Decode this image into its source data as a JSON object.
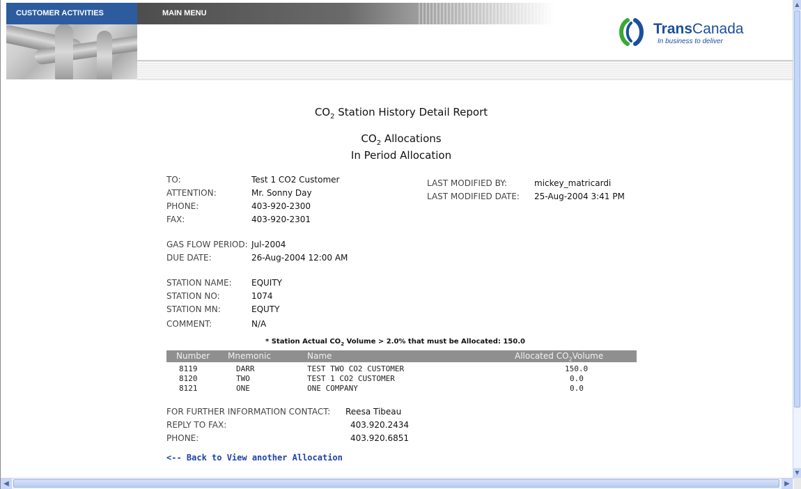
{
  "nav": {
    "customer_activities": "CUSTOMER ACTIVITIES",
    "main_menu": "MAIN MENU"
  },
  "logo": {
    "name_bold": "Trans",
    "name_rest": "Canada",
    "tagline": "In business to deliver",
    "colors": {
      "green": "#39a935",
      "blue": "#1a4f9c"
    }
  },
  "report": {
    "title_pre": "CO",
    "title_sub": "2",
    "title_post": " Station History Detail Report",
    "subtitle_pre": "CO",
    "subtitle_sub": "2",
    "subtitle_post": " Allocations",
    "subtitle2": "In Period Allocation"
  },
  "contact": {
    "to_label": "TO:",
    "to_value": "Test 1 CO2 Customer",
    "attention_label": "ATTENTION:",
    "attention_value": "Mr. Sonny Day",
    "phone_label": "PHONE:",
    "phone_value": "403-920-2300",
    "fax_label": "FAX:",
    "fax_value": "403-920-2301",
    "modified_by_label": "LAST MODIFIED BY:",
    "modified_by_value": "mickey_matricardi",
    "modified_date_label": "LAST MODIFIED DATE:",
    "modified_date_value": "25-Aug-2004 3:41 PM"
  },
  "period": {
    "gas_flow_label": "GAS FLOW PERIOD:",
    "gas_flow_value": "Jul-2004",
    "due_date_label": "DUE DATE:",
    "due_date_value": "26-Aug-2004 12:00 AM"
  },
  "station": {
    "name_label": "STATION NAME:",
    "name_value": "EQUITY",
    "no_label": "STATION NO:",
    "no_value": "1074",
    "mn_label": "STATION MN:",
    "mn_value": "EQUTY",
    "comment_label": "COMMENT:",
    "comment_value": "N/A"
  },
  "note": {
    "pre": "* Station Actual CO",
    "sub": "2",
    "post": " Volume > 2.0% that must be Allocated: 150.0"
  },
  "table": {
    "headers": {
      "number": "Number",
      "mnemonic": "Mnemonic",
      "name": "Name",
      "volume_pre": "Allocated CO",
      "volume_sub": "2",
      "volume_post": "Volume"
    },
    "rows": [
      {
        "number": "8119",
        "mnemonic": "DARR",
        "name": "TEST TWO CO2 CUSTOMER",
        "volume": "150.0"
      },
      {
        "number": "8120",
        "mnemonic": "TWO",
        "name": "TEST 1 CO2 CUSTOMER",
        "volume": "0.0"
      },
      {
        "number": "8121",
        "mnemonic": "ONE",
        "name": "ONE COMPANY",
        "volume": "0.0"
      }
    ]
  },
  "footer": {
    "further_label": "FOR FURTHER INFORMATION CONTACT:",
    "further_value": "Reesa Tibeau",
    "reply_fax_label": "REPLY TO FAX:",
    "reply_fax_value": "403.920.2434",
    "phone_label": "PHONE:",
    "phone_value": "403.920.6851"
  },
  "back_link": "<-- Back to View another Allocation"
}
